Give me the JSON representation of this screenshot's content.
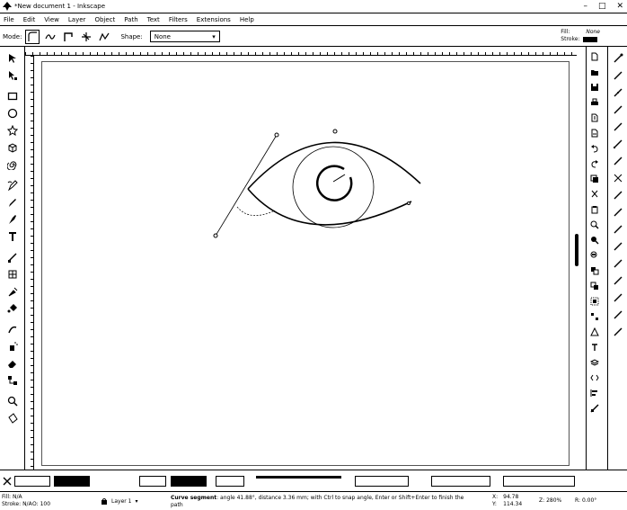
{
  "window": {
    "title": "*New document 1 - Inkscape"
  },
  "menu": [
    "File",
    "Edit",
    "View",
    "Layer",
    "Object",
    "Path",
    "Text",
    "Filters",
    "Extensions",
    "Help"
  ],
  "controls": {
    "mode_label": "Mode:",
    "shape_label": "Shape:",
    "shape_value": "None"
  },
  "style_indicator": {
    "fill_label": "Fill:",
    "fill_value": "None",
    "stroke_label": "Stroke:"
  },
  "status": {
    "fill_label": "Fill:",
    "fill_value": "N/A",
    "stroke_label": "Stroke:",
    "stroke_value": "N/A",
    "opacity_label": "O:",
    "opacity_value": "100",
    "layer_name": "Layer 1",
    "message_bold": "Curve segment",
    "message_rest": ": angle 41.88°, distance 3.36 mm; with Ctrl to snap angle, Enter or Shift+Enter to finish the path",
    "x_label": "X:",
    "x_value": "94.78",
    "y_label": "Y:",
    "y_value": "114.34",
    "zoom_label": "Z:",
    "zoom_value": "280%",
    "rotate_label": "R:",
    "rotate_value": "0.00°"
  },
  "colors": {
    "ink": "#000000",
    "page_border": "#555555"
  },
  "icons": {
    "tools": [
      "selector-icon",
      "node-icon",
      "rect-icon",
      "circle-icon",
      "star-icon",
      "3dbox-icon",
      "spiral-icon",
      "pen-icon",
      "pencil-icon",
      "calligraphy-icon",
      "text-icon",
      "gradient-icon",
      "mesh-icon",
      "dropper-icon",
      "paint-bucket-icon",
      "tweak-icon",
      "spray-icon",
      "eraser-icon",
      "connector-icon",
      "zoom-icon",
      "measure-icon"
    ]
  }
}
